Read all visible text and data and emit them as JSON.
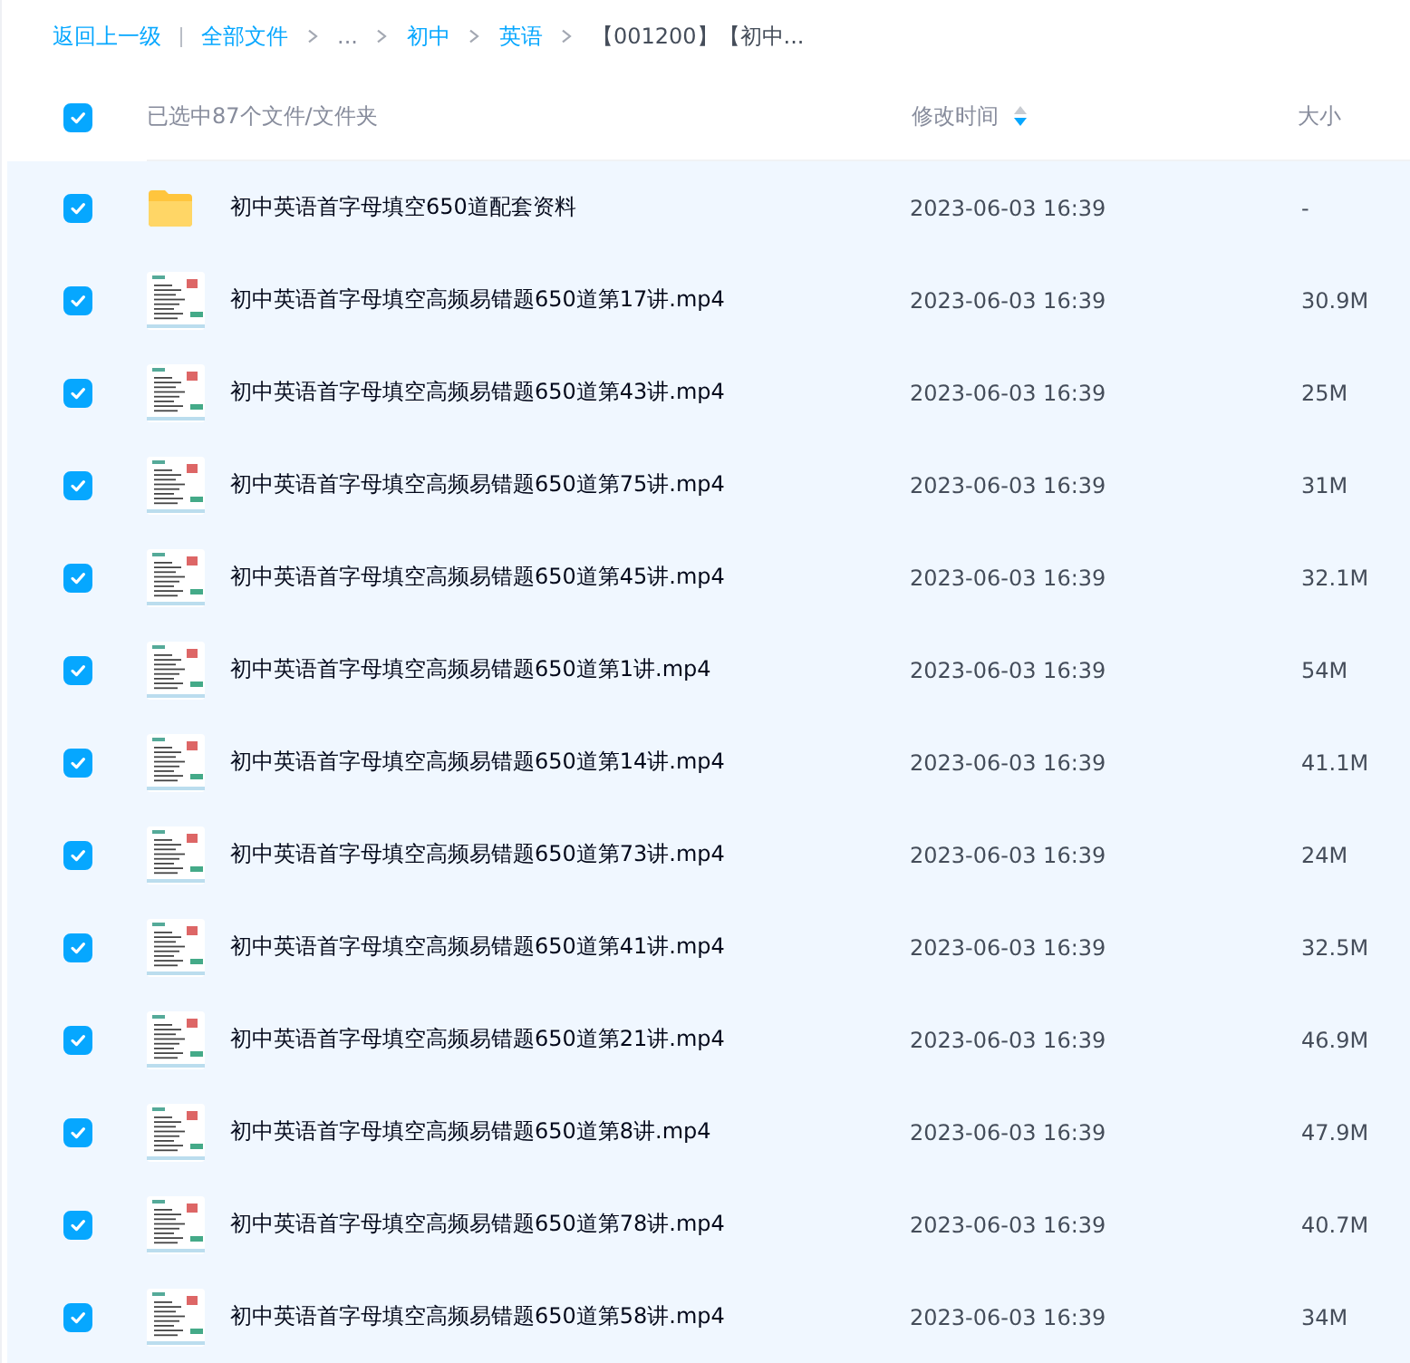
{
  "breadcrumb": {
    "back": "返回上一级",
    "items": [
      {
        "label": "全部文件",
        "kind": "link"
      },
      {
        "label": "...",
        "kind": "ellipsis"
      },
      {
        "label": "初中",
        "kind": "link"
      },
      {
        "label": "英语",
        "kind": "link"
      },
      {
        "label": "【001200】【初中...",
        "kind": "current"
      }
    ]
  },
  "header": {
    "checked": true,
    "selection": "已选中87个文件/文件夹",
    "columns": [
      {
        "label": "修改时间",
        "sort_descending": true
      },
      {
        "label": "大小",
        "sort_descending": false
      }
    ]
  },
  "rows": [
    {
      "kind": "folder",
      "name": "初中英语首字母填空650道配套资料",
      "modified": "2023-06-03 16:39",
      "size": "-",
      "selected": true
    },
    {
      "kind": "video",
      "name": "初中英语首字母填空高频易错题650道第17讲.mp4",
      "modified": "2023-06-03 16:39",
      "size": "30.9M",
      "selected": true
    },
    {
      "kind": "video",
      "name": "初中英语首字母填空高频易错题650道第43讲.mp4",
      "modified": "2023-06-03 16:39",
      "size": "25M",
      "selected": true
    },
    {
      "kind": "video",
      "name": "初中英语首字母填空高频易错题650道第75讲.mp4",
      "modified": "2023-06-03 16:39",
      "size": "31M",
      "selected": true
    },
    {
      "kind": "video",
      "name": "初中英语首字母填空高频易错题650道第45讲.mp4",
      "modified": "2023-06-03 16:39",
      "size": "32.1M",
      "selected": true
    },
    {
      "kind": "video",
      "name": "初中英语首字母填空高频易错题650道第1讲.mp4",
      "modified": "2023-06-03 16:39",
      "size": "54M",
      "selected": true
    },
    {
      "kind": "video",
      "name": "初中英语首字母填空高频易错题650道第14讲.mp4",
      "modified": "2023-06-03 16:39",
      "size": "41.1M",
      "selected": true
    },
    {
      "kind": "video",
      "name": "初中英语首字母填空高频易错题650道第73讲.mp4",
      "modified": "2023-06-03 16:39",
      "size": "24M",
      "selected": true
    },
    {
      "kind": "video",
      "name": "初中英语首字母填空高频易错题650道第41讲.mp4",
      "modified": "2023-06-03 16:39",
      "size": "32.5M",
      "selected": true
    },
    {
      "kind": "video",
      "name": "初中英语首字母填空高频易错题650道第21讲.mp4",
      "modified": "2023-06-03 16:39",
      "size": "46.9M",
      "selected": true
    },
    {
      "kind": "video",
      "name": "初中英语首字母填空高频易错题650道第8讲.mp4",
      "modified": "2023-06-03 16:39",
      "size": "47.9M",
      "selected": true
    },
    {
      "kind": "video",
      "name": "初中英语首字母填空高频易错题650道第78讲.mp4",
      "modified": "2023-06-03 16:39",
      "size": "40.7M",
      "selected": true
    },
    {
      "kind": "video",
      "name": "初中英语首字母填空高频易错题650道第58讲.mp4",
      "modified": "2023-06-03 16:39",
      "size": "34M",
      "selected": true
    }
  ]
}
